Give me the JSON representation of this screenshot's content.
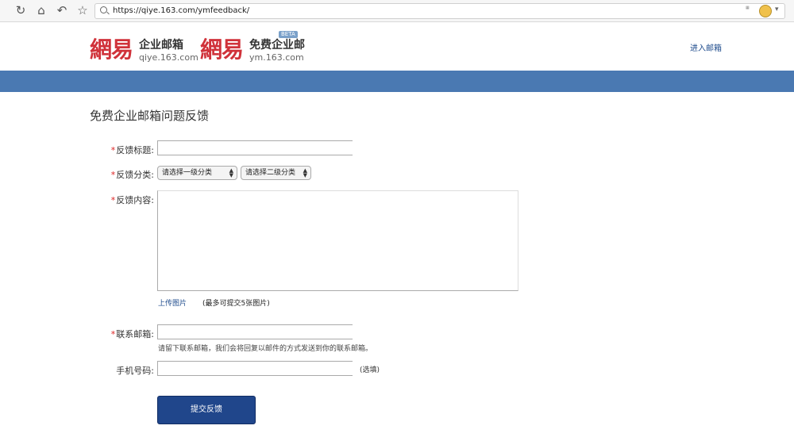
{
  "browser": {
    "url": "https://qiye.163.com/ymfeedback/",
    "nav_icons": [
      "reload-icon",
      "home-icon",
      "back-icon",
      "bookmark-star-icon"
    ]
  },
  "header": {
    "logo_enterprise": {
      "mark": "網易",
      "name": "企业邮箱",
      "domain": "qiye.163.com"
    },
    "logo_free": {
      "mark": "網易",
      "name": "免费企业邮",
      "domain": "ym.163.com",
      "badge": "BETA"
    },
    "enter_mail_link": "进入邮箱"
  },
  "colors": {
    "band": "#4a79b2",
    "brand_red": "#d0323a",
    "button": "#20468b",
    "link": "#1e4b8c"
  },
  "form": {
    "title": "免费企业邮箱问题反馈",
    "required_mark": "*",
    "subject_label": "反馈标题:",
    "category_label": "反馈分类:",
    "category_level1": "请选择一级分类",
    "category_level2": "请选择二级分类",
    "content_label": "反馈内容:",
    "upload_link": "上传图片",
    "upload_note": "(最多可提交5张图片)",
    "email_label": "联系邮箱:",
    "email_hint": "请留下联系邮箱，我们会将回复以邮件的方式发送到你的联系邮箱。",
    "phone_label": "手机号码:",
    "phone_optional": "(选填)",
    "submit_label": "提交反馈"
  }
}
